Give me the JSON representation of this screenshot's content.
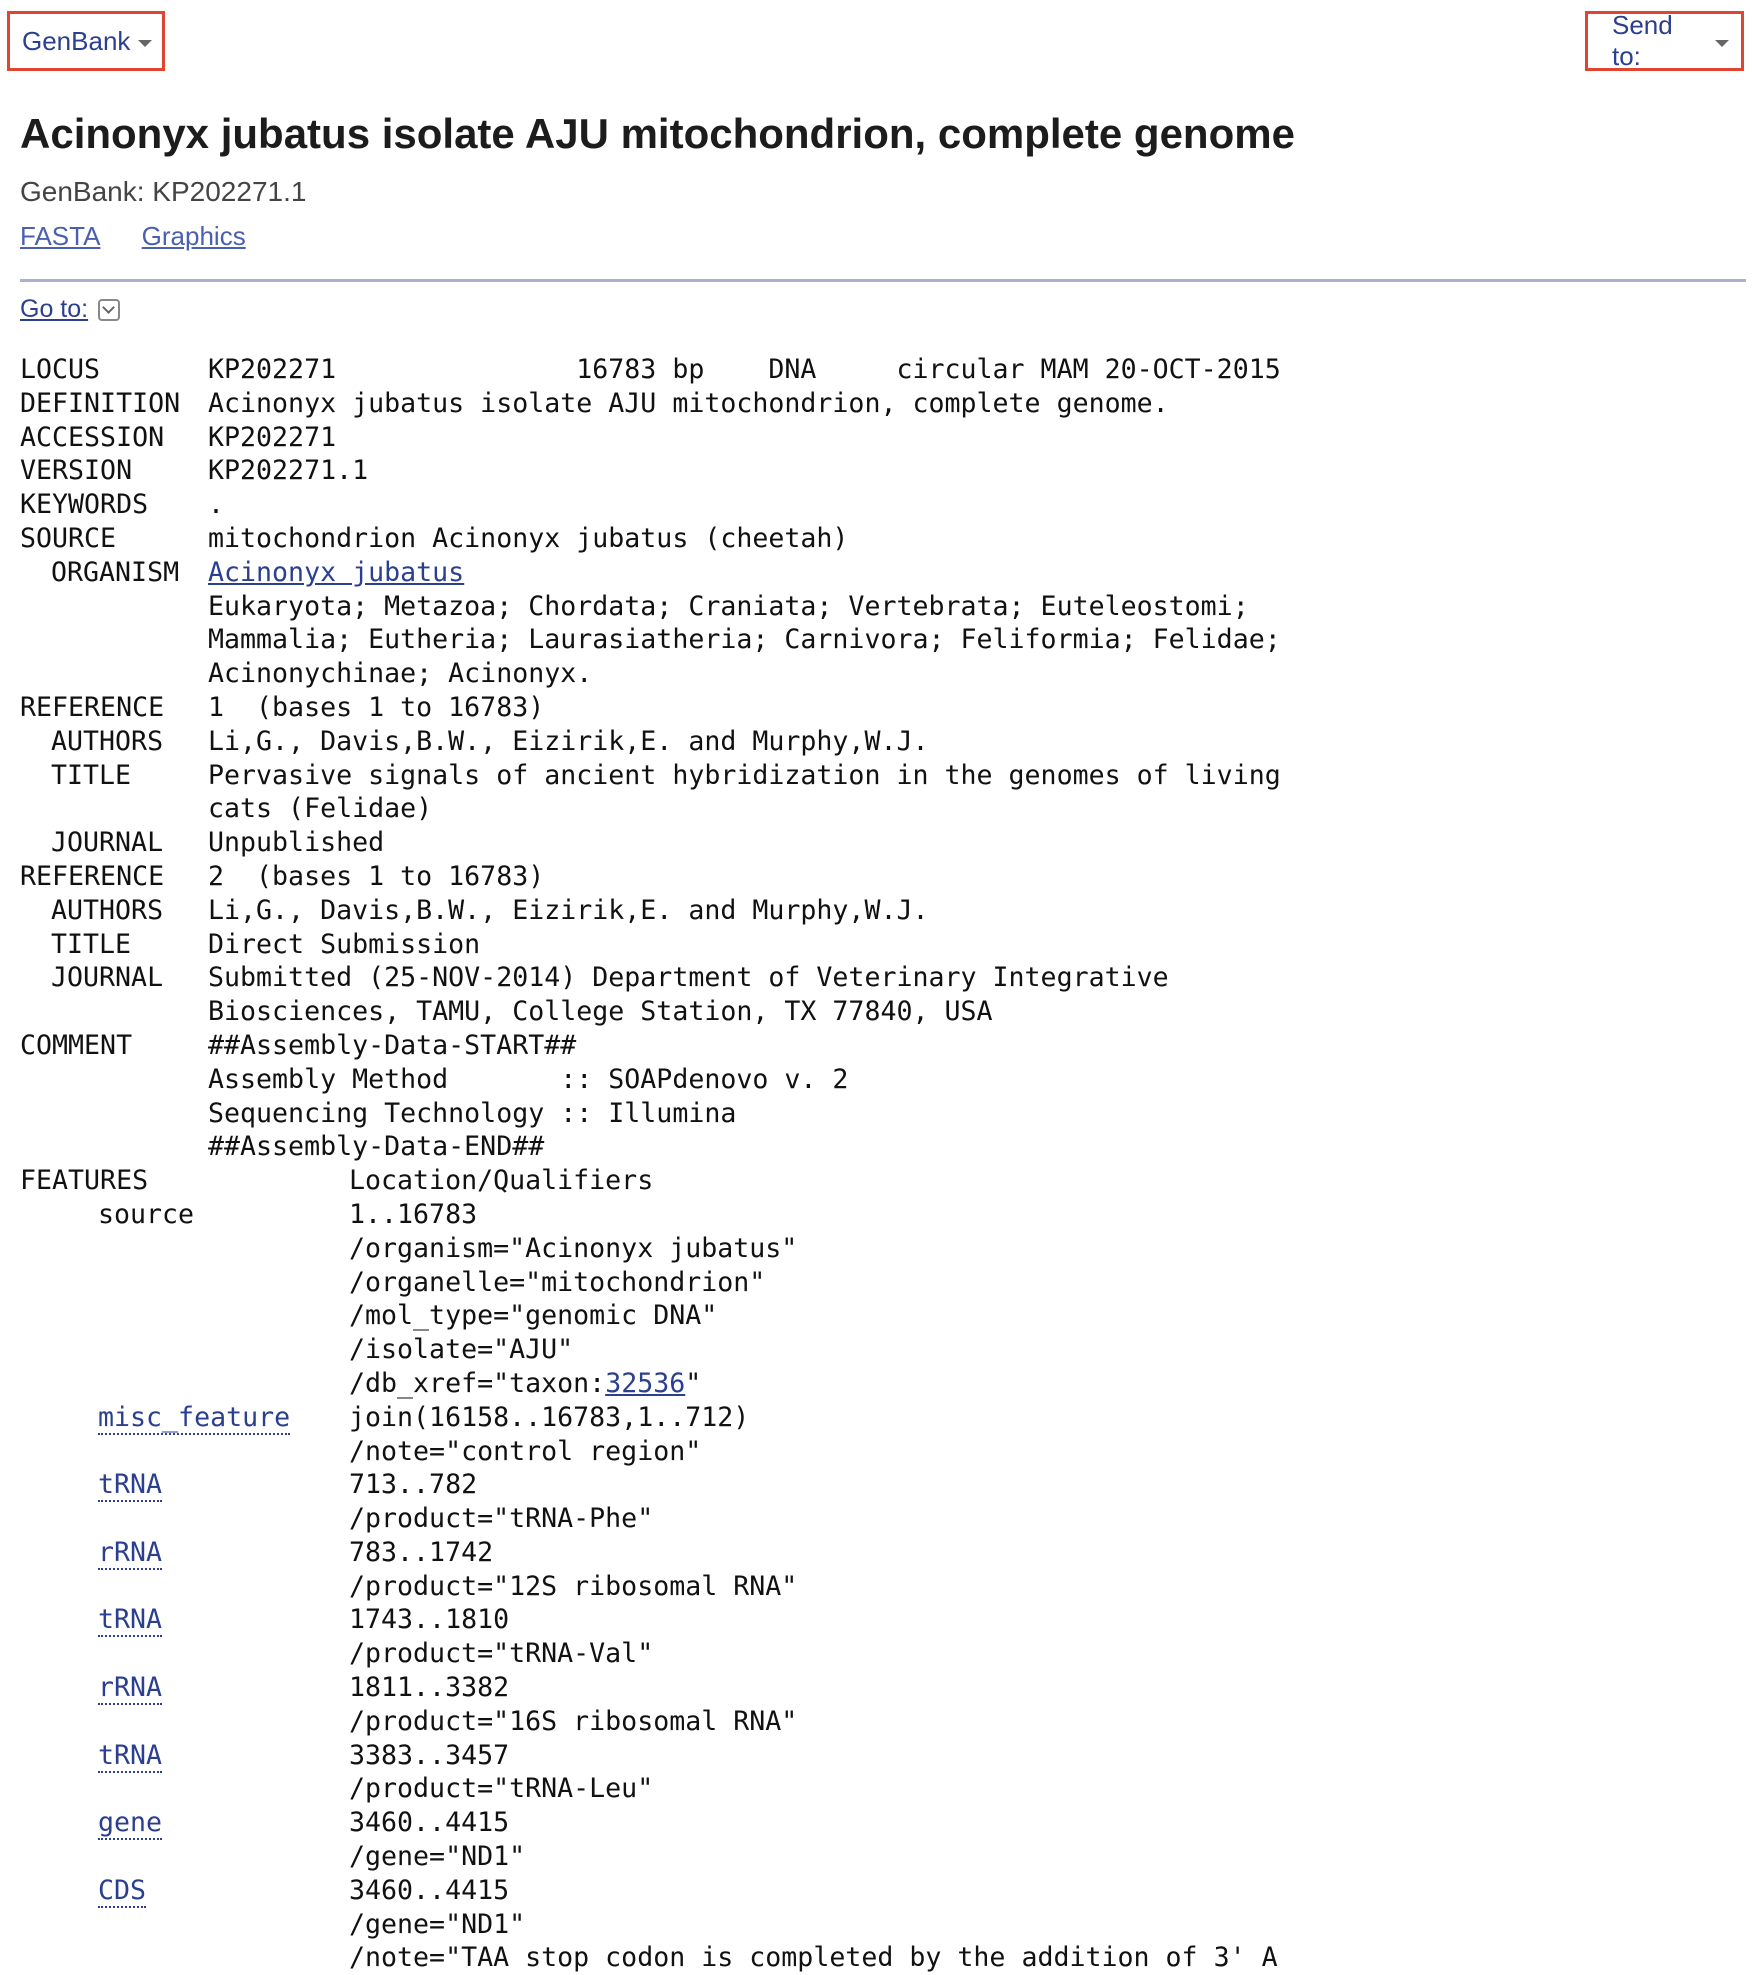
{
  "header": {
    "db_label": "GenBank",
    "send_label": "Send to:"
  },
  "title": "Acinonyx jubatus isolate AJU mitochondrion, complete genome",
  "subtitle": "GenBank: KP202271.1",
  "format_links": [
    "FASTA",
    "Graphics"
  ],
  "goto_label": "Go to:",
  "record": {
    "locus": {
      "label": "LOCUS",
      "value": "KP202271               16783 bp    DNA     circular MAM 20-OCT-2015"
    },
    "definition": {
      "label": "DEFINITION",
      "value": "Acinonyx jubatus isolate AJU mitochondrion, complete genome."
    },
    "accession": {
      "label": "ACCESSION",
      "value": "KP202271"
    },
    "version": {
      "label": "VERSION",
      "value": "KP202271.1"
    },
    "keywords": {
      "label": "KEYWORDS",
      "value": "."
    },
    "source": {
      "label": "SOURCE",
      "value": "mitochondrion Acinonyx jubatus (cheetah)"
    },
    "organism": {
      "label": "ORGANISM",
      "link": "Acinonyx jubatus",
      "lineage": [
        "Eukaryota; Metazoa; Chordata; Craniata; Vertebrata; Euteleostomi;",
        "Mammalia; Eutheria; Laurasiatheria; Carnivora; Feliformia; Felidae;",
        "Acinonychinae; Acinonyx."
      ]
    },
    "references": [
      {
        "label": "REFERENCE",
        "value": "1  (bases 1 to 16783)",
        "authors_label": "AUTHORS",
        "authors": "Li,G., Davis,B.W., Eizirik,E. and Murphy,W.J.",
        "title_label": "TITLE",
        "title": [
          "Pervasive signals of ancient hybridization in the genomes of living",
          "cats (Felidae)"
        ],
        "journal_label": "JOURNAL",
        "journal": [
          "Unpublished"
        ]
      },
      {
        "label": "REFERENCE",
        "value": "2  (bases 1 to 16783)",
        "authors_label": "AUTHORS",
        "authors": "Li,G., Davis,B.W., Eizirik,E. and Murphy,W.J.",
        "title_label": "TITLE",
        "title": [
          "Direct Submission"
        ],
        "journal_label": "JOURNAL",
        "journal": [
          "Submitted (25-NOV-2014) Department of Veterinary Integrative",
          "Biosciences, TAMU, College Station, TX 77840, USA"
        ]
      }
    ],
    "comment": {
      "label": "COMMENT",
      "lines": [
        "##Assembly-Data-START##",
        "Assembly Method       :: SOAPdenovo v. 2",
        "Sequencing Technology :: Illumina",
        "##Assembly-Data-END##"
      ]
    },
    "features": {
      "label": "FEATURES",
      "header": "Location/Qualifiers",
      "source_key": "source",
      "source_lines": [
        "1..16783",
        "/organism=\"Acinonyx jubatus\"",
        "/organelle=\"mitochondrion\"",
        "/mol_type=\"genomic DNA\"",
        "/isolate=\"AJU\""
      ],
      "db_xref_prefix": "/db_xref=\"taxon:",
      "db_xref_id": "32536",
      "db_xref_suffix": "\"",
      "items": [
        {
          "key": "misc_feature",
          "lines": [
            "join(16158..16783,1..712)",
            "/note=\"control region\""
          ]
        },
        {
          "key": "tRNA",
          "lines": [
            "713..782",
            "/product=\"tRNA-Phe\""
          ]
        },
        {
          "key": "rRNA",
          "lines": [
            "783..1742",
            "/product=\"12S ribosomal RNA\""
          ]
        },
        {
          "key": "tRNA",
          "lines": [
            "1743..1810",
            "/product=\"tRNA-Val\""
          ]
        },
        {
          "key": "rRNA",
          "lines": [
            "1811..3382",
            "/product=\"16S ribosomal RNA\""
          ]
        },
        {
          "key": "tRNA",
          "lines": [
            "3383..3457",
            "/product=\"tRNA-Leu\""
          ]
        },
        {
          "key": "gene",
          "lines": [
            "3460..4415",
            "/gene=\"ND1\""
          ]
        },
        {
          "key": "CDS",
          "lines": [
            "3460..4415",
            "/gene=\"ND1\"",
            "/note=\"TAA stop codon is completed by the addition of 3' A"
          ]
        }
      ]
    }
  }
}
